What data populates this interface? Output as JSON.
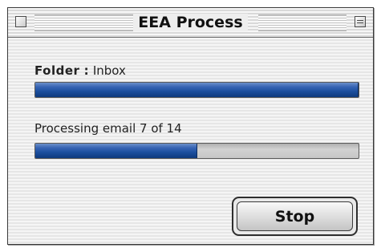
{
  "window": {
    "title": "EEA Process"
  },
  "folder": {
    "key_label": "Folder",
    "separator": " : ",
    "value": "Inbox",
    "progress_fraction": 1.0
  },
  "processing": {
    "status_text": "Processing email 7 of 14",
    "current": 7,
    "total": 14,
    "progress_fraction": 0.5
  },
  "buttons": {
    "stop_label": "Stop"
  },
  "colors": {
    "progress_fill": "#1c4f9e",
    "progress_track": "#c6c6c6"
  }
}
